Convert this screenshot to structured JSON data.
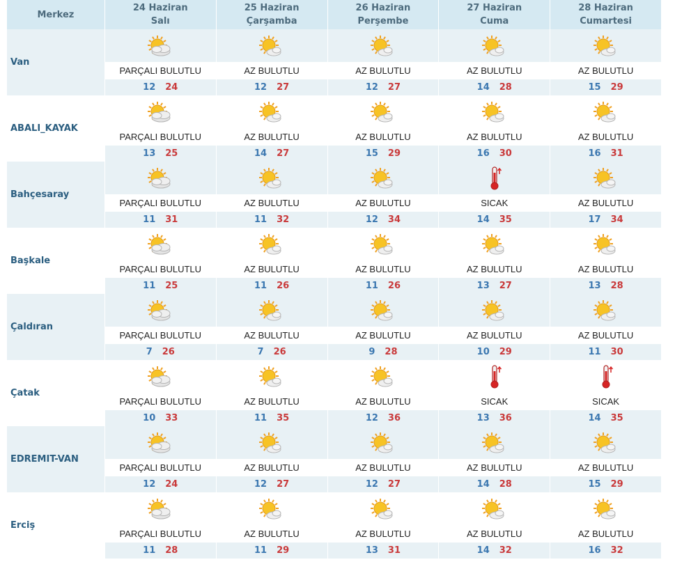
{
  "header": {
    "center_label": "Merkez",
    "days": [
      {
        "date": "24 Haziran",
        "weekday": "Salı"
      },
      {
        "date": "25 Haziran",
        "weekday": "Çarşamba"
      },
      {
        "date": "26 Haziran",
        "weekday": "Perşembe"
      },
      {
        "date": "27 Haziran",
        "weekday": "Cuma"
      },
      {
        "date": "28 Haziran",
        "weekday": "Cumartesi"
      }
    ]
  },
  "rows": [
    {
      "city": "Van",
      "days": [
        {
          "icon": "partly-cloudy-icon",
          "cond": "PARÇALI BULUTLU",
          "lo": "12",
          "hi": "24"
        },
        {
          "icon": "mostly-sunny-icon",
          "cond": "AZ BULUTLU",
          "lo": "12",
          "hi": "27"
        },
        {
          "icon": "mostly-sunny-icon",
          "cond": "AZ BULUTLU",
          "lo": "12",
          "hi": "27"
        },
        {
          "icon": "mostly-sunny-icon",
          "cond": "AZ BULUTLU",
          "lo": "14",
          "hi": "28"
        },
        {
          "icon": "mostly-sunny-icon",
          "cond": "AZ BULUTLU",
          "lo": "15",
          "hi": "29"
        }
      ]
    },
    {
      "city": "ABALI_KAYAK",
      "days": [
        {
          "icon": "partly-cloudy-icon",
          "cond": "PARÇALI BULUTLU",
          "lo": "13",
          "hi": "25"
        },
        {
          "icon": "mostly-sunny-icon",
          "cond": "AZ BULUTLU",
          "lo": "14",
          "hi": "27"
        },
        {
          "icon": "mostly-sunny-icon",
          "cond": "AZ BULUTLU",
          "lo": "15",
          "hi": "29"
        },
        {
          "icon": "mostly-sunny-icon",
          "cond": "AZ BULUTLU",
          "lo": "16",
          "hi": "30"
        },
        {
          "icon": "mostly-sunny-icon",
          "cond": "AZ BULUTLU",
          "lo": "16",
          "hi": "31"
        }
      ]
    },
    {
      "city": "Bahçesaray",
      "days": [
        {
          "icon": "partly-cloudy-icon",
          "cond": "PARÇALI BULUTLU",
          "lo": "11",
          "hi": "31"
        },
        {
          "icon": "mostly-sunny-icon",
          "cond": "AZ BULUTLU",
          "lo": "11",
          "hi": "32"
        },
        {
          "icon": "mostly-sunny-icon",
          "cond": "AZ BULUTLU",
          "lo": "12",
          "hi": "34"
        },
        {
          "icon": "thermometer-icon",
          "cond": "SICAK",
          "lo": "14",
          "hi": "35"
        },
        {
          "icon": "mostly-sunny-icon",
          "cond": "AZ BULUTLU",
          "lo": "17",
          "hi": "34"
        }
      ]
    },
    {
      "city": "Başkale",
      "days": [
        {
          "icon": "partly-cloudy-icon",
          "cond": "PARÇALI BULUTLU",
          "lo": "11",
          "hi": "25"
        },
        {
          "icon": "mostly-sunny-icon",
          "cond": "AZ BULUTLU",
          "lo": "11",
          "hi": "26"
        },
        {
          "icon": "mostly-sunny-icon",
          "cond": "AZ BULUTLU",
          "lo": "11",
          "hi": "26"
        },
        {
          "icon": "mostly-sunny-icon",
          "cond": "AZ BULUTLU",
          "lo": "13",
          "hi": "27"
        },
        {
          "icon": "mostly-sunny-icon",
          "cond": "AZ BULUTLU",
          "lo": "13",
          "hi": "28"
        }
      ]
    },
    {
      "city": "Çaldıran",
      "days": [
        {
          "icon": "partly-cloudy-icon",
          "cond": "PARÇALI BULUTLU",
          "lo": "7",
          "hi": "26"
        },
        {
          "icon": "mostly-sunny-icon",
          "cond": "AZ BULUTLU",
          "lo": "7",
          "hi": "26"
        },
        {
          "icon": "mostly-sunny-icon",
          "cond": "AZ BULUTLU",
          "lo": "9",
          "hi": "28"
        },
        {
          "icon": "mostly-sunny-icon",
          "cond": "AZ BULUTLU",
          "lo": "10",
          "hi": "29"
        },
        {
          "icon": "mostly-sunny-icon",
          "cond": "AZ BULUTLU",
          "lo": "11",
          "hi": "30"
        }
      ]
    },
    {
      "city": "Çatak",
      "days": [
        {
          "icon": "partly-cloudy-icon",
          "cond": "PARÇALI BULUTLU",
          "lo": "10",
          "hi": "33"
        },
        {
          "icon": "mostly-sunny-icon",
          "cond": "AZ BULUTLU",
          "lo": "11",
          "hi": "35"
        },
        {
          "icon": "mostly-sunny-icon",
          "cond": "AZ BULUTLU",
          "lo": "12",
          "hi": "36"
        },
        {
          "icon": "thermometer-icon",
          "cond": "SICAK",
          "lo": "13",
          "hi": "36"
        },
        {
          "icon": "thermometer-icon",
          "cond": "SICAK",
          "lo": "14",
          "hi": "35"
        }
      ]
    },
    {
      "city": "EDREMIT-VAN",
      "days": [
        {
          "icon": "partly-cloudy-icon",
          "cond": "PARÇALI BULUTLU",
          "lo": "12",
          "hi": "24"
        },
        {
          "icon": "mostly-sunny-icon",
          "cond": "AZ BULUTLU",
          "lo": "12",
          "hi": "27"
        },
        {
          "icon": "mostly-sunny-icon",
          "cond": "AZ BULUTLU",
          "lo": "12",
          "hi": "27"
        },
        {
          "icon": "mostly-sunny-icon",
          "cond": "AZ BULUTLU",
          "lo": "14",
          "hi": "28"
        },
        {
          "icon": "mostly-sunny-icon",
          "cond": "AZ BULUTLU",
          "lo": "15",
          "hi": "29"
        }
      ]
    },
    {
      "city": "Erciş",
      "days": [
        {
          "icon": "partly-cloudy-icon",
          "cond": "PARÇALI BULUTLU",
          "lo": "11",
          "hi": "28"
        },
        {
          "icon": "mostly-sunny-icon",
          "cond": "AZ BULUTLU",
          "lo": "11",
          "hi": "29"
        },
        {
          "icon": "mostly-sunny-icon",
          "cond": "AZ BULUTLU",
          "lo": "13",
          "hi": "31"
        },
        {
          "icon": "mostly-sunny-icon",
          "cond": "AZ BULUTLU",
          "lo": "14",
          "hi": "32"
        },
        {
          "icon": "mostly-sunny-icon",
          "cond": "AZ BULUTLU",
          "lo": "16",
          "hi": "32"
        }
      ]
    }
  ],
  "colors": {
    "header_bg": "#d5e9f2",
    "shade_bg": "#e8f1f5",
    "low_temp": "#3b77b0",
    "high_temp": "#c9393a",
    "city_text": "#2b5e80"
  }
}
